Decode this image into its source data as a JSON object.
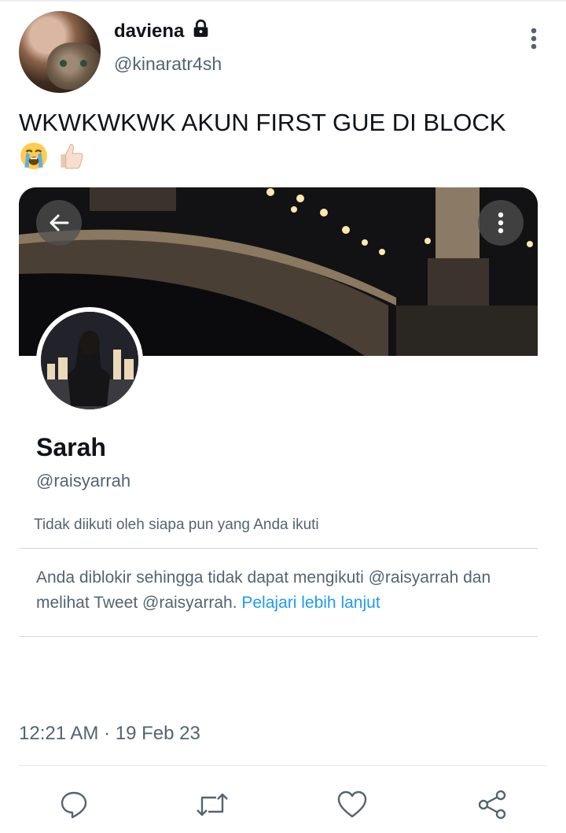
{
  "author": {
    "display_name": "daviena",
    "handle": "@kinaratr4sh"
  },
  "tweet": {
    "text": "WKWKWKWK AKUN FIRST GUE DI BLOCK",
    "emojis": [
      "loudly-crying-face",
      "thumbs-up-light-skin"
    ]
  },
  "profile_card": {
    "name": "Sarah",
    "handle": "@raisyarrah",
    "follow_note": "Tidak diikuti oleh siapa pun yang Anda ikuti",
    "blocked_message": "Anda diblokir sehingga tidak dapat mengikuti @raisyarrah dan melihat Tweet @raisyarrah.",
    "learn_more": "Pelajari lebih lanjut"
  },
  "timestamp": "12:21 AM · 19 Feb 23",
  "actions": [
    "reply-icon",
    "retweet-icon",
    "like-icon",
    "share-icon"
  ],
  "colors": {
    "text": "#0f1419",
    "secondary": "#536471",
    "link": "#1d9bf0"
  }
}
